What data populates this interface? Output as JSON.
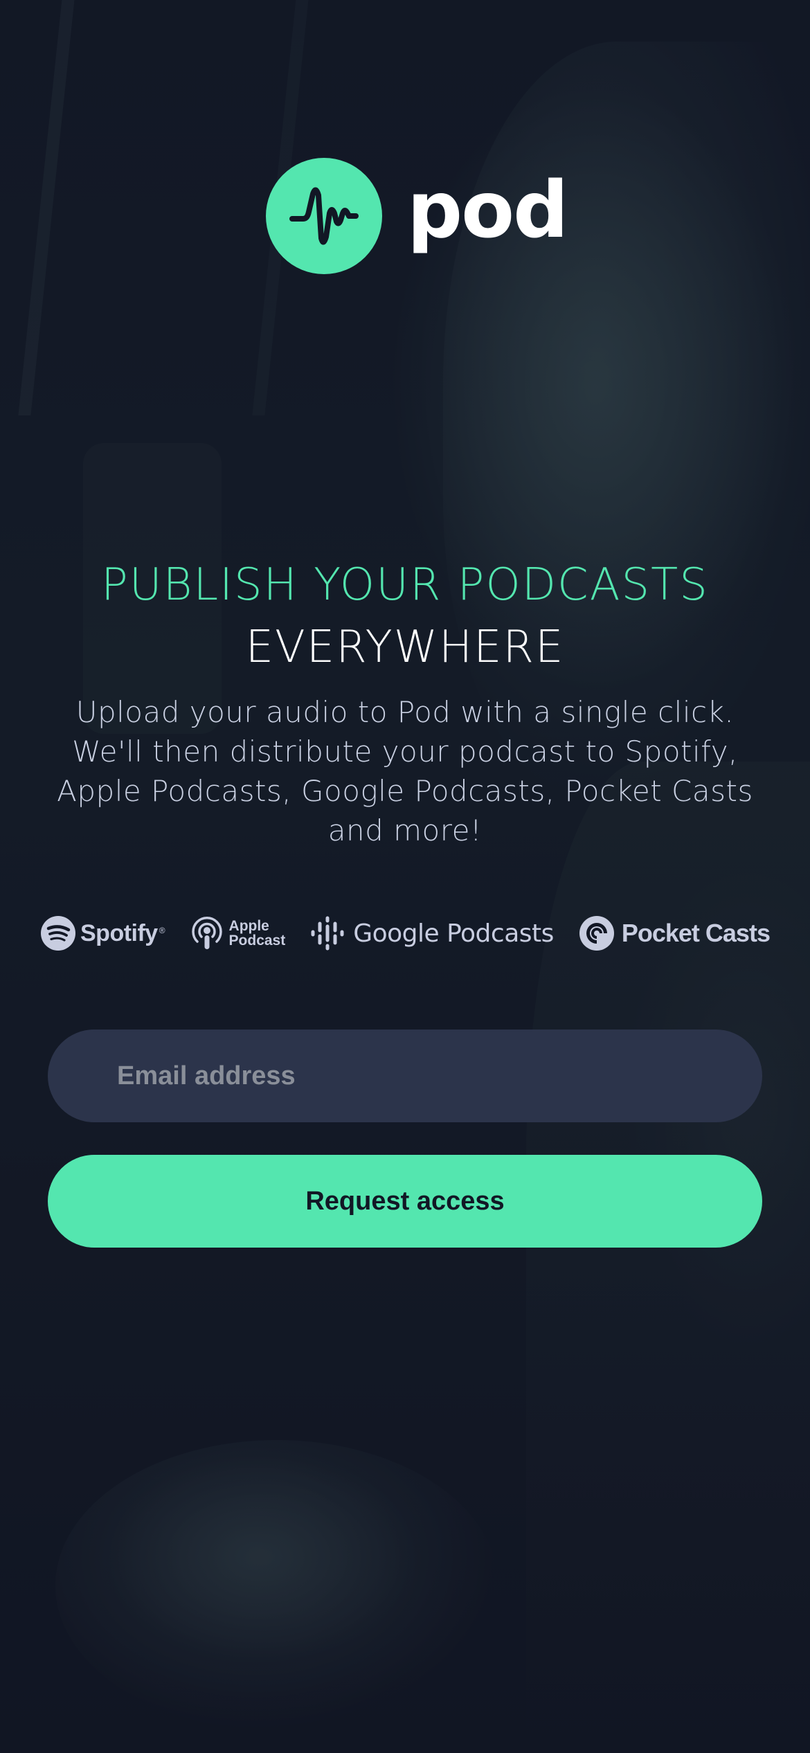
{
  "brand": {
    "name": "pod",
    "accent_color": "#54e6af",
    "background_color": "#121725",
    "logo_icon": "waveform-icon"
  },
  "hero": {
    "title_accent": "PUBLISH YOUR PODCASTS",
    "title_rest": "EVERYWHERE",
    "description": "Upload your audio to Pod with a single click. We'll then distribute your podcast to Spotify, Apple Podcasts, Google Podcasts, Pocket Casts and more!"
  },
  "platforms": {
    "spotify": {
      "name": "Spotify",
      "icon": "spotify-icon"
    },
    "apple": {
      "line1": "Apple",
      "line2": "Podcast",
      "icon": "apple-podcast-icon"
    },
    "google": {
      "name": "Google Podcasts",
      "icon": "google-podcasts-icon"
    },
    "pocket": {
      "name": "Pocket Casts",
      "icon": "pocket-casts-icon"
    }
  },
  "form": {
    "email_placeholder": "Email address",
    "email_value": "",
    "submit_label": "Request access"
  }
}
